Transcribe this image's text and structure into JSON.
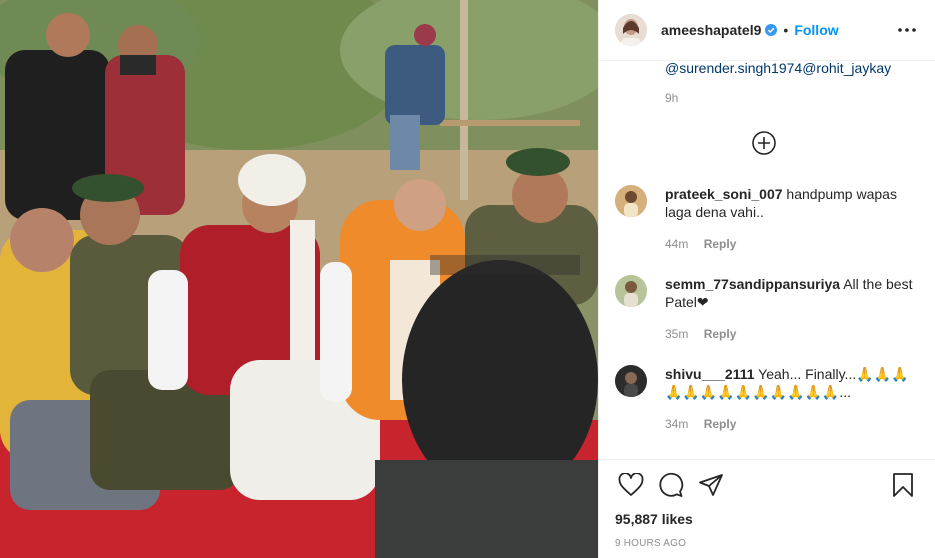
{
  "post": {
    "username": "ameeshapatel9",
    "follow_label": "Follow",
    "dot": "•",
    "caption_tail": "@surender.singh1974@rohit_jaykay",
    "caption_time": "9h",
    "likes": "95,887 likes",
    "posted": "9 HOURS AGO"
  },
  "comments": [
    {
      "user": "prateek_soni_007",
      "text": "handpump wapas laga dena vahi..",
      "time": "44m",
      "reply": "Reply"
    },
    {
      "user": "semm_77sandippansuriya",
      "text": "All the best Patel❤",
      "time": "35m",
      "reply": "Reply"
    },
    {
      "user": "shivu___2111",
      "text": "Yeah... Finally...🙏🙏🙏🙏🙏🙏🙏🙏🙏🙏🙏🙏🙏...",
      "time": "34m",
      "reply": "Reply"
    }
  ],
  "icons": {
    "more": "more-options-icon",
    "load_more": "plus-circle-icon",
    "like": "heart-icon",
    "comment": "comment-icon",
    "share": "share-icon",
    "save": "bookmark-icon",
    "verified": "verified-badge-icon"
  },
  "colors": {
    "accent": "#0095f6",
    "text": "#262626",
    "muted": "#8e8e8e",
    "border": "#efefef"
  }
}
